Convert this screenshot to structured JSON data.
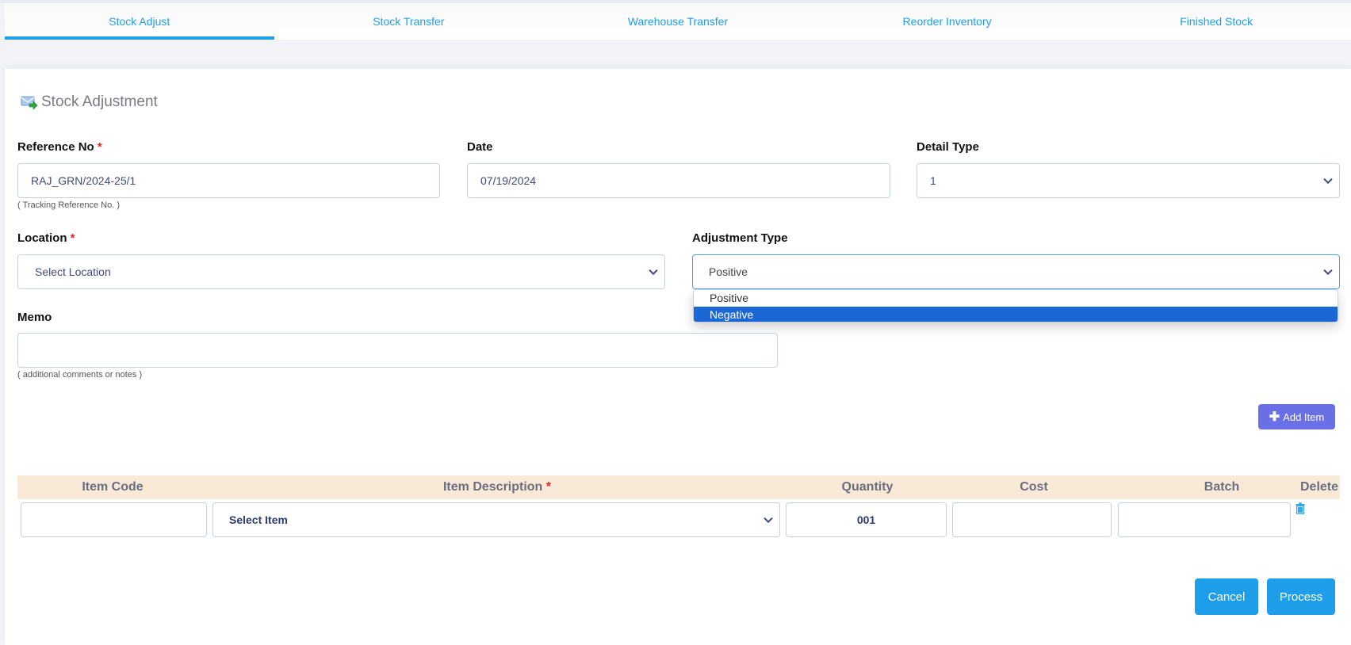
{
  "tabs": [
    {
      "label": "Stock Adjust",
      "active": true
    },
    {
      "label": "Stock Transfer",
      "active": false
    },
    {
      "label": "Warehouse Transfer",
      "active": false
    },
    {
      "label": "Reorder Inventory",
      "active": false
    },
    {
      "label": "Finished Stock",
      "active": false
    }
  ],
  "page": {
    "title": "Stock Adjustment",
    "icon": "stock-adjust-icon"
  },
  "form": {
    "reference_no": {
      "label": "Reference No",
      "required_mark": "*",
      "value": "RAJ_GRN/2024-25/1",
      "hint": "( Tracking Reference No. )"
    },
    "date": {
      "label": "Date",
      "value": "07/19/2024"
    },
    "detail_type": {
      "label": "Detail Type",
      "value": "1"
    },
    "location": {
      "label": "Location",
      "required_mark": "*",
      "value": "Select Location"
    },
    "adjustment_type": {
      "label": "Adjustment Type",
      "value": "Positive",
      "options": [
        {
          "label": "Positive",
          "highlighted": false
        },
        {
          "label": "Negative",
          "highlighted": true
        }
      ]
    },
    "memo": {
      "label": "Memo",
      "value": "",
      "hint": "( additional comments or notes )"
    }
  },
  "buttons": {
    "add_item": "Add Item",
    "add_item_icon": "plus-icon",
    "cancel": "Cancel",
    "process": "Process"
  },
  "items_table": {
    "columns": [
      {
        "label": "Item Code"
      },
      {
        "label": "Item Description",
        "required_mark": "*"
      },
      {
        "label": "Quantity"
      },
      {
        "label": "Cost"
      },
      {
        "label": "Batch"
      },
      {
        "label": "Delete"
      }
    ],
    "rows": [
      {
        "item_code": "",
        "item_description": "Select Item",
        "quantity": "001",
        "cost": "",
        "batch": "",
        "delete_icon": "trash-icon"
      }
    ]
  },
  "colors": {
    "accent": "#1e9ee8",
    "add_button": "#6b6fe6",
    "dropdown_highlight": "#1b68d4",
    "table_header_bg": "#f9e9d7",
    "required": "#ee2222"
  }
}
